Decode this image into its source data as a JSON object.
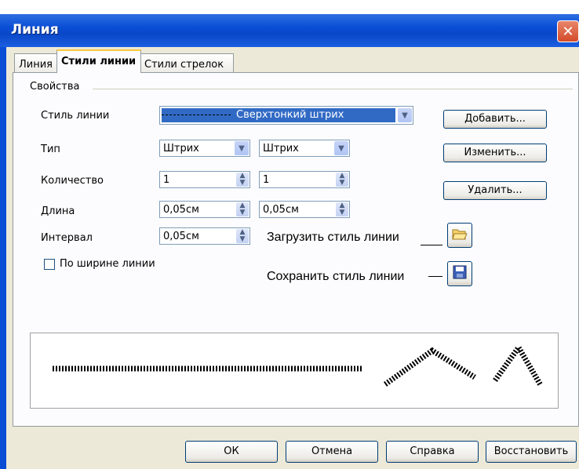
{
  "window": {
    "title": "Линия",
    "close_glyph": "✕"
  },
  "tabs": [
    {
      "label": "Линия",
      "active": false
    },
    {
      "label": "Стили линии",
      "active": true
    },
    {
      "label": "Стили стрелок",
      "active": false
    }
  ],
  "properties": {
    "group_label": "Свойства",
    "line_style_label": "Стиль линии",
    "line_style_value": "Сверхтонкий штрих",
    "type_label": "Тип",
    "type_value_1": "Штрих",
    "type_value_2": "Штрих",
    "count_label": "Количество",
    "count_value_1": "1",
    "count_value_2": "1",
    "length_label": "Длина",
    "length_value_1": "0,05см",
    "length_value_2": "0,05см",
    "interval_label": "Интервал",
    "interval_value": "0,05см",
    "fit_width_label": "По ширине линии",
    "fit_width_checked": false
  },
  "buttons": {
    "add": "Добавить...",
    "modify": "Изменить...",
    "delete": "Удалить..."
  },
  "annotations": {
    "load": "Загрузить стиль линии",
    "save": "Сохранить стиль линии"
  },
  "icons": {
    "load": "folder-open-icon",
    "save": "floppy-disk-icon"
  },
  "footer": {
    "ok": "ОК",
    "cancel": "Отмена",
    "help": "Справка",
    "reset": "Восстановить"
  },
  "colors": {
    "titlebar": "#0a4ed6",
    "selection": "#316ac5",
    "tab_accent": "#ffc83c"
  }
}
